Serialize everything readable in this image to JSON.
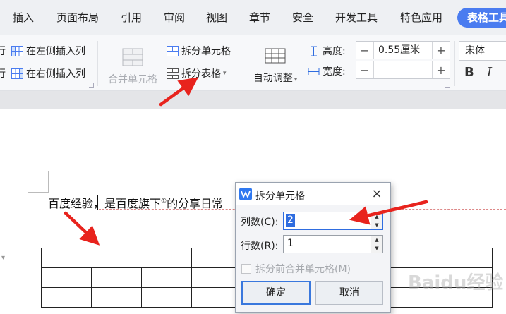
{
  "tabs": [
    "插入",
    "页面布局",
    "引用",
    "审阅",
    "视图",
    "章节",
    "安全",
    "开发工具",
    "特色应用",
    "表格工具"
  ],
  "ribbon": {
    "partial_row_label_top": "行",
    "partial_row_label_bottom": "行",
    "insert_left_col": "在左侧插入列",
    "insert_right_col": "在右侧插入列",
    "merge_cells": "合并单元格",
    "split_cells": "拆分单元格",
    "split_table": "拆分表格",
    "auto_adjust": "自动调整",
    "height_label": "高度:",
    "height_value": "0.55厘米",
    "width_label": "宽度:",
    "width_value": "",
    "minus": "−",
    "plus": "+",
    "font_name": "宋体",
    "bold": "B",
    "italic": "I"
  },
  "document": {
    "text_before": "百度经验，是百度旗下",
    "footnote_mark": "①",
    "text_after": "的分享日常"
  },
  "watermark": "Baidu经验",
  "dialog": {
    "title": "拆分单元格",
    "close": "×",
    "cols_label": "列数(C):",
    "cols_value": "2",
    "rows_label": "行数(R):",
    "rows_value": "1",
    "merge_before_split": "拆分前合并单元格(M)",
    "merge_before_split_checked": false,
    "ok": "确定",
    "cancel": "取消"
  },
  "colors": {
    "accent_tab": "#4a7cf0",
    "annotation_arrow": "#e8231d",
    "dialog_focus": "#2f6de0"
  }
}
